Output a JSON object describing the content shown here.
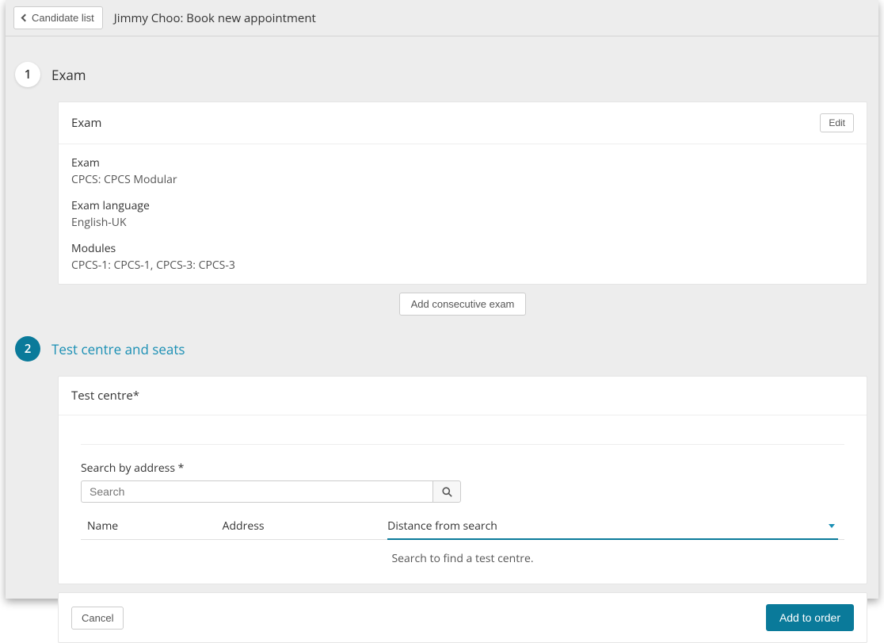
{
  "header": {
    "back_label": "Candidate list",
    "page_title": "Jimmy Choo: Book new appointment"
  },
  "steps": {
    "s1": {
      "num": "1",
      "title": "Exam"
    },
    "s2": {
      "num": "2",
      "title": "Test centre and seats"
    }
  },
  "exam_card": {
    "title": "Exam",
    "edit_label": "Edit",
    "fields": {
      "exam": {
        "label": "Exam",
        "value": "CPCS: CPCS Modular"
      },
      "language": {
        "label": "Exam language",
        "value": "English-UK"
      },
      "modules": {
        "label": "Modules",
        "value": "CPCS-1: CPCS-1, CPCS-3: CPCS-3"
      }
    }
  },
  "add_consecutive_label": "Add consecutive exam",
  "test_centre": {
    "title": "Test centre*",
    "search_label": "Search by address *",
    "search_placeholder": "Search",
    "columns": {
      "name": "Name",
      "address": "Address",
      "distance": "Distance from search"
    },
    "empty_text": "Search to find a test centre."
  },
  "footer": {
    "cancel_label": "Cancel",
    "add_label": "Add to order"
  }
}
